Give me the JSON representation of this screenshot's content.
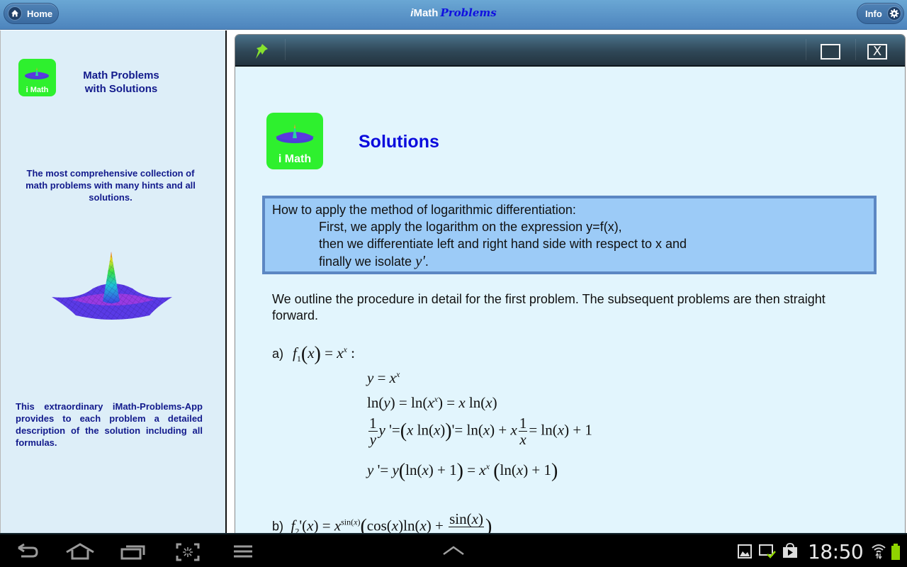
{
  "header": {
    "home_label": "Home",
    "title_prefix_i": "i",
    "title_math": "Math",
    "title_problems": "Problems",
    "info_label": "Info",
    "home_icon": "home-icon",
    "info_icon": "gear-icon",
    "accent_color": "#4d84bd"
  },
  "sidebar": {
    "logo_label": "i Math",
    "heading_line1": "Math Problems",
    "heading_line2": "with Solutions",
    "description": "The most comprehensive collection of math problems with many hints and all solutions.",
    "footer": "This extraordinary iMath-Problems-App provides to each problem a detailed description of the solution including all formulas.",
    "text_color": "#121a8c",
    "bg_color": "#ddeef8"
  },
  "panel": {
    "toolbar": {
      "pin_icon": "pushpin-icon",
      "maximize_icon": "maximize-icon",
      "close_icon": "close-icon",
      "close_glyph": "X"
    },
    "logo_label": "i Math",
    "heading": "Solutions",
    "method": {
      "line1": "How to apply the method of logarithmic differentiation:",
      "line2": "First, we apply the logarithm on the expression y=f(x),",
      "line3": "then we differentiate left and right hand side with respect to x and",
      "line4_text": "finally we isolate ",
      "line4_var": "y'",
      "line4_end": "."
    },
    "intro": "We outline the procedure in detail for the first problem. The subsequent problems are then straight forward.",
    "problem_a": {
      "label": "a)",
      "statement": "f1(x) = x^x :",
      "steps": [
        "y = x^x",
        "ln(y) = ln(x^x) = x ln(x)",
        "(1/y) y' = (x ln(x))' = ln(x) + x (1/x) = ln(x) + 1",
        "y' = y(ln(x) + 1) = x^x (ln(x) + 1)"
      ]
    },
    "problem_b": {
      "label": "b)",
      "statement_partial": "f2'(x) = x^sin(x) ( cos(x)ln(x) + sin(x)/… )"
    }
  },
  "system_bar": {
    "nav": [
      "back-icon",
      "home-icon",
      "recent-apps-icon",
      "screenshot-icon",
      "menu-icon"
    ],
    "center": "chevron-up-icon",
    "status_icons": [
      "gallery-icon",
      "screen-check-icon",
      "play-store-icon"
    ],
    "time": "18:50",
    "wifi_icon": "wifi-icon",
    "battery_icon": "battery-icon",
    "battery_color": "#8fd400"
  }
}
